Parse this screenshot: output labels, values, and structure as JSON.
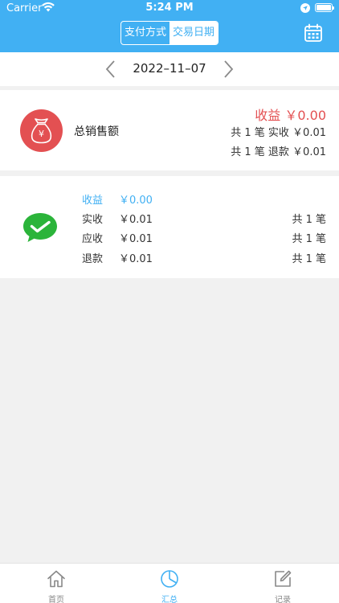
{
  "status_bar": {
    "carrier": "Carrier",
    "time": "5:24 PM"
  },
  "header": {
    "segment": [
      {
        "label": "支付方式",
        "active": false
      },
      {
        "label": "交易日期",
        "active": true
      }
    ],
    "calendar_icon": "calendar-icon"
  },
  "date_nav": {
    "date": "2022–11–07"
  },
  "summary": {
    "label": "总销售额",
    "profit": "收益 ￥0.00",
    "received": "共 1 笔 实收 ￥0.01",
    "refund": "共 1 笔 退款 ￥0.01"
  },
  "wechat": {
    "rows": [
      {
        "label": "收益",
        "value": "￥0.00",
        "count": ""
      },
      {
        "label": "实收",
        "value": "￥0.01",
        "count": "共 1 笔"
      },
      {
        "label": "应收",
        "value": "￥0.01",
        "count": "共 1 笔"
      },
      {
        "label": "退款",
        "value": "￥0.01",
        "count": "共 1 笔"
      }
    ]
  },
  "tabbar": {
    "tabs": [
      {
        "label": "首页",
        "icon": "home-icon",
        "active": false
      },
      {
        "label": "汇总",
        "icon": "pie-chart-icon",
        "active": true
      },
      {
        "label": "记录",
        "icon": "edit-icon",
        "active": false
      }
    ]
  },
  "colors": {
    "accent": "#41b0f3",
    "profit_red": "#e35052",
    "wechat_green": "#2bb43a"
  }
}
